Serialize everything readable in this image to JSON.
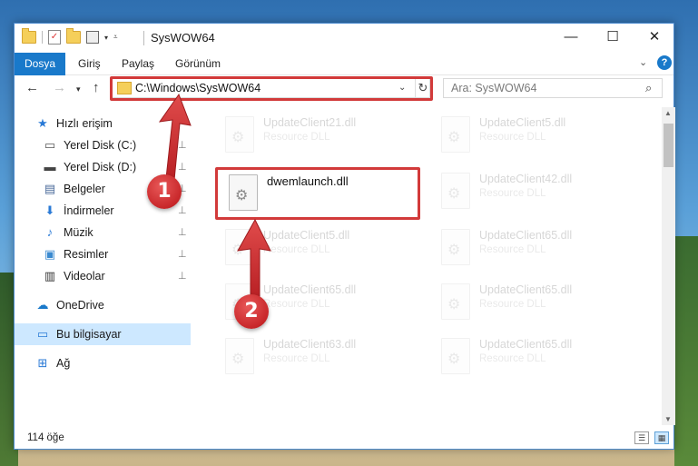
{
  "window": {
    "title": "SysWOW64"
  },
  "title_buttons": {
    "minimize": "—",
    "maximize": "☐",
    "close": "✕"
  },
  "ribbon": {
    "tabs": [
      {
        "label": "Dosya"
      },
      {
        "label": "Giriş"
      },
      {
        "label": "Paylaş"
      },
      {
        "label": "Görünüm"
      }
    ],
    "collapse_glyph": "⌄",
    "help_glyph": "?"
  },
  "navigation": {
    "back_glyph": "←",
    "forward_glyph": "→",
    "recent_glyph": "▾",
    "up_glyph": "↑"
  },
  "address_bar": {
    "path": "C:\\Windows\\SysWOW64",
    "dropdown_glyph": "⌄",
    "refresh_glyph": "↻"
  },
  "search": {
    "placeholder": "Ara: SysWOW64",
    "icon_glyph": "⌕"
  },
  "sidebar": {
    "items": [
      {
        "label": "Hızlı erişim",
        "icon": "★"
      },
      {
        "label": "Yerel Disk (C:)",
        "icon": "▭",
        "pinned": true
      },
      {
        "label": "Yerel Disk (D:)",
        "icon": "▬",
        "pinned": true
      },
      {
        "label": "Belgeler",
        "icon": "▤",
        "pinned": true
      },
      {
        "label": "İndirmeler",
        "icon": "⬇",
        "pinned": true
      },
      {
        "label": "Müzik",
        "icon": "♪",
        "pinned": true
      },
      {
        "label": "Resimler",
        "icon": "▣",
        "pinned": true
      },
      {
        "label": "Videolar",
        "icon": "▥",
        "pinned": true
      },
      {
        "label": "OneDrive",
        "icon": "☁"
      },
      {
        "label": "Bu bilgisayar",
        "icon": "▭",
        "selected": true
      },
      {
        "label": "Ağ",
        "icon": "⊞"
      }
    ],
    "pin_glyph": "📌"
  },
  "files": [
    {
      "name": "UpdateClient21.dll",
      "type": "Resource DLL"
    },
    {
      "name": "UpdateClient5.dll",
      "type": "Resource DLL"
    },
    {
      "name": "dwemlaunch.dll",
      "type": ""
    },
    {
      "name": "UpdateClient42.dll",
      "type": "Resource DLL"
    },
    {
      "name": "UpdateClient5.dll",
      "type": "Resource DLL"
    },
    {
      "name": "UpdateClient65.dll",
      "type": "Resource DLL"
    },
    {
      "name": "UpdateClient65.dll",
      "type": "Resource DLL"
    },
    {
      "name": "UpdateClient65.dll",
      "type": "Resource DLL"
    },
    {
      "name": "UpdateClient63.dll",
      "type": "Resource DLL"
    },
    {
      "name": "UpdateClient65.dll",
      "type": "Resource DLL"
    }
  ],
  "status_bar": {
    "item_count": "114 öğe"
  },
  "callouts": {
    "step1": "1",
    "step2": "2"
  },
  "colors": {
    "accent": "#1979ca",
    "highlight": "#d23a3a",
    "selected_bg": "#cde8ff"
  }
}
